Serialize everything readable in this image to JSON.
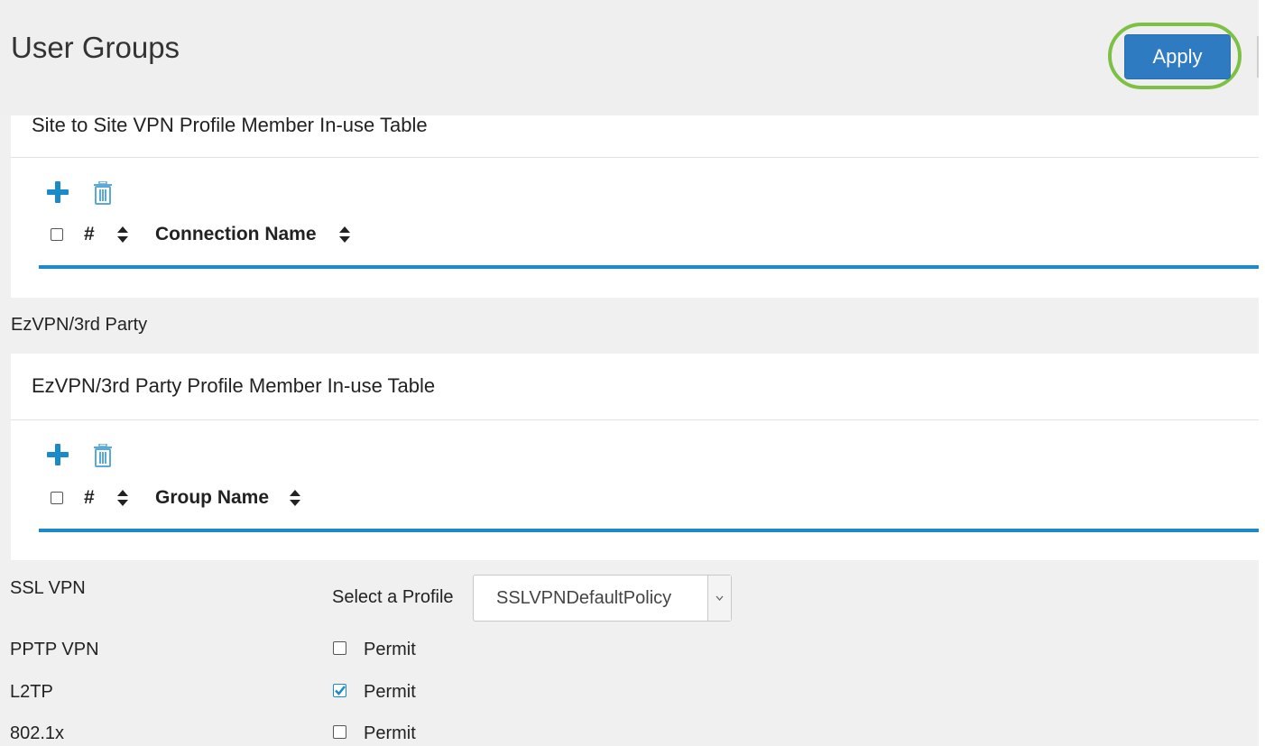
{
  "header": {
    "title": "User Groups",
    "apply_label": "Apply"
  },
  "s2s_card": {
    "title": "Site to Site VPN Profile Member In-use Table",
    "columns": [
      "#",
      "Connection Name"
    ]
  },
  "ezvpn": {
    "section_label": "EzVPN/3rd Party",
    "card_title": "EzVPN/3rd Party Profile Member In-use Table",
    "columns": [
      "#",
      "Group Name"
    ]
  },
  "ssl": {
    "label": "SSL VPN",
    "select_label": "Select a Profile",
    "selected_value": "SSLVPNDefaultPolicy"
  },
  "rows": [
    {
      "label": "PPTP VPN",
      "permit_label": "Permit",
      "checked": false
    },
    {
      "label": "L2TP",
      "permit_label": "Permit",
      "checked": true
    },
    {
      "label": "802.1x",
      "permit_label": "Permit",
      "checked": false
    }
  ],
  "colors": {
    "accent": "#1b8ac8",
    "apply_button": "#2f7bc2",
    "highlight": "#7cc044"
  },
  "icons": {
    "add": "plus-icon",
    "delete": "trash-icon",
    "sort": "sort-icon",
    "dropdown": "chevron-down-icon"
  }
}
